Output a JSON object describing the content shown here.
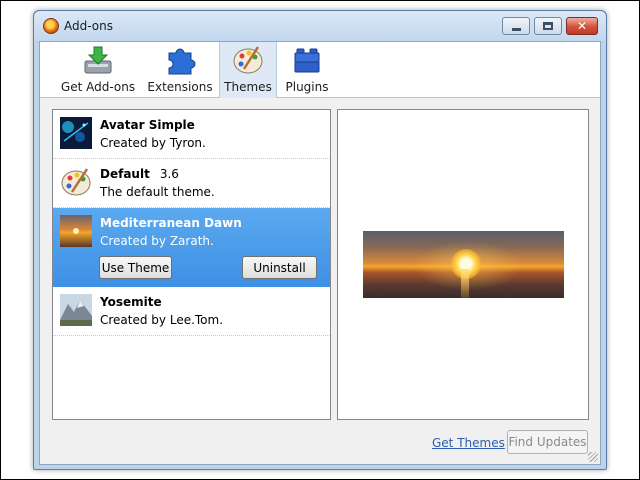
{
  "window": {
    "title": "Add-ons",
    "icons": {
      "app": "firefox-icon",
      "minimize": "minimize-icon",
      "maximize": "maximize-icon",
      "close": "close-icon"
    },
    "close_glyph": "✕"
  },
  "toolbar": {
    "tabs": [
      {
        "label": "Get Add-ons",
        "icon": "download-box-icon",
        "selected": false
      },
      {
        "label": "Extensions",
        "icon": "puzzle-piece-icon",
        "selected": false
      },
      {
        "label": "Themes",
        "icon": "palette-icon",
        "selected": true
      },
      {
        "label": "Plugins",
        "icon": "lego-brick-icon",
        "selected": false
      }
    ]
  },
  "themes": [
    {
      "name": "Avatar Simple",
      "version": "",
      "description": "Created by Tyron.",
      "selected": false
    },
    {
      "name": "Default",
      "version": "3.6",
      "description": "The default theme.",
      "selected": false
    },
    {
      "name": "Mediterranean Dawn",
      "version": "",
      "description": "Created by Zarath.",
      "selected": true,
      "actions": {
        "use_theme": "Use Theme",
        "uninstall": "Uninstall"
      }
    },
    {
      "name": "Yosemite",
      "version": "",
      "description": "Created by Lee.Tom.",
      "selected": false
    }
  ],
  "preview": {
    "subject": "sunrise-over-sea-preview"
  },
  "footer": {
    "get_themes": "Get Themes",
    "find_updates": "Find Updates"
  },
  "colors": {
    "selection": "#3d90e4",
    "link": "#2a5db0",
    "tab_selected_bg": "#dfe9f5"
  }
}
